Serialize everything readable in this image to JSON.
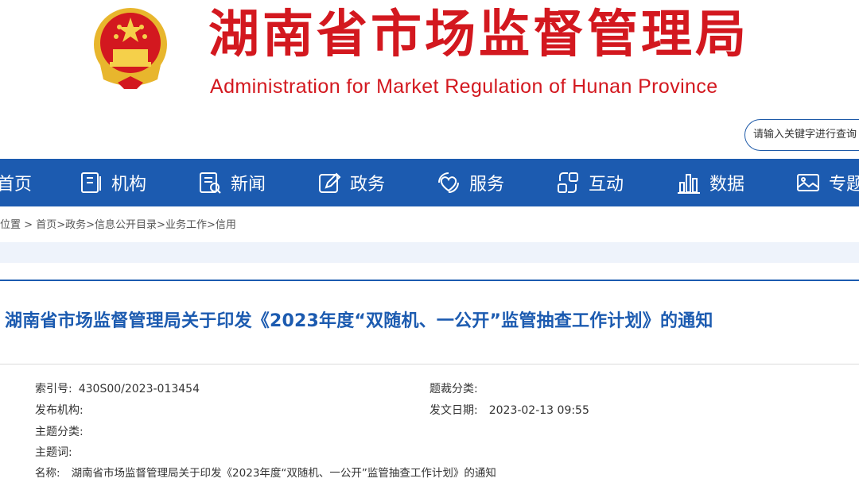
{
  "header": {
    "title_cn": "湖南省市场监督管理局",
    "title_en": "Administration for Market Regulation of Hunan Province",
    "brand_color": "#d3181f",
    "emblem_icon": "national-emblem"
  },
  "search": {
    "placeholder": "请输入关键字进行查询"
  },
  "nav": {
    "background": "#1c5bb0",
    "items": [
      {
        "label": "首页",
        "icon": "home-icon"
      },
      {
        "label": "机构",
        "icon": "building-icon"
      },
      {
        "label": "新闻",
        "icon": "news-icon"
      },
      {
        "label": "政务",
        "icon": "edit-icon"
      },
      {
        "label": "服务",
        "icon": "service-heart-icon"
      },
      {
        "label": "互动",
        "icon": "interaction-icon"
      },
      {
        "label": "数据",
        "icon": "bar-chart-icon"
      },
      {
        "label": "专题",
        "icon": "image-icon"
      }
    ]
  },
  "breadcrumb": {
    "prefix": "当前位置",
    "items": [
      "首页",
      "政务",
      "信息公开目录",
      "业务工作",
      "信用"
    ]
  },
  "article": {
    "title": "湖南省市场监督管理局关于印发《2023年度“双随机、一公开”监管抽查工作计划》的通知",
    "meta": {
      "index_label": "索引号:",
      "index_value": "430S00/2023-013454",
      "genre_label": "题裁分类:",
      "genre_value": "",
      "publisher_label": "发布机构:",
      "publisher_value": "",
      "date_label": "发文日期:",
      "date_value": "2023-02-13 09:55",
      "topic_label": "主题分类:",
      "topic_value": "",
      "keywords_label": "主题词:",
      "keywords_value": "",
      "name_label": "名称:",
      "name_value": "湖南省市场监督管理局关于印发《2023年度“双随机、一公开”监管抽查工作计划》的通知"
    }
  }
}
